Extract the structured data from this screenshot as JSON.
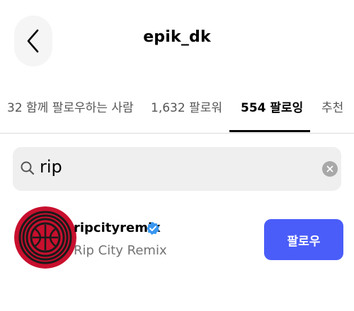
{
  "header": {
    "back_icon": "chevron-left-icon",
    "title": "epik_dk"
  },
  "tabs": [
    {
      "label": "32 함께 팔로우하는 사람",
      "active": false
    },
    {
      "label": "1,632 팔로워",
      "active": false
    },
    {
      "label": "554 팔로잉",
      "active": true
    },
    {
      "label": "추천",
      "active": false
    }
  ],
  "search": {
    "icon": "search-icon",
    "value": "rip",
    "clear_icon": "clear-icon"
  },
  "results": [
    {
      "username": "ripcityremix",
      "verified": true,
      "full_name": "Rip City Remix",
      "follow_label": "팔로우"
    }
  ],
  "colors": {
    "accent": "#4a5df9",
    "verified": "#3897f0",
    "avatar_red": "#c8102e",
    "search_bg": "#efefef"
  }
}
